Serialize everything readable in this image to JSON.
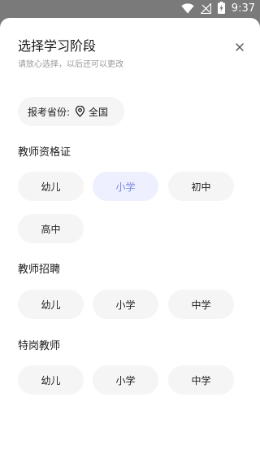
{
  "status_bar": {
    "time": "9:37",
    "icons": [
      "wifi-icon",
      "no-signal-icon",
      "battery-charging-icon"
    ]
  },
  "sheet": {
    "title": "选择学习阶段",
    "subtitle": "请放心选择，以后还可以更改",
    "close_icon": "close-icon"
  },
  "province": {
    "label": "报考省份:",
    "icon": "location-pin-icon",
    "value": "全国"
  },
  "sections": [
    {
      "title": "教师资格证",
      "options": [
        "幼儿",
        "小学",
        "初中",
        "高中"
      ],
      "selected": "小学"
    },
    {
      "title": "教师招聘",
      "options": [
        "幼儿",
        "小学",
        "中学"
      ]
    },
    {
      "title": "特岗教师",
      "options": [
        "幼儿",
        "小学",
        "中学"
      ]
    }
  ],
  "colors": {
    "selected_bg": "#eef0ff",
    "selected_text": "#7b85e8",
    "pill_bg": "#f5f5f5",
    "status_bar_bg": "#7a7a7a"
  }
}
